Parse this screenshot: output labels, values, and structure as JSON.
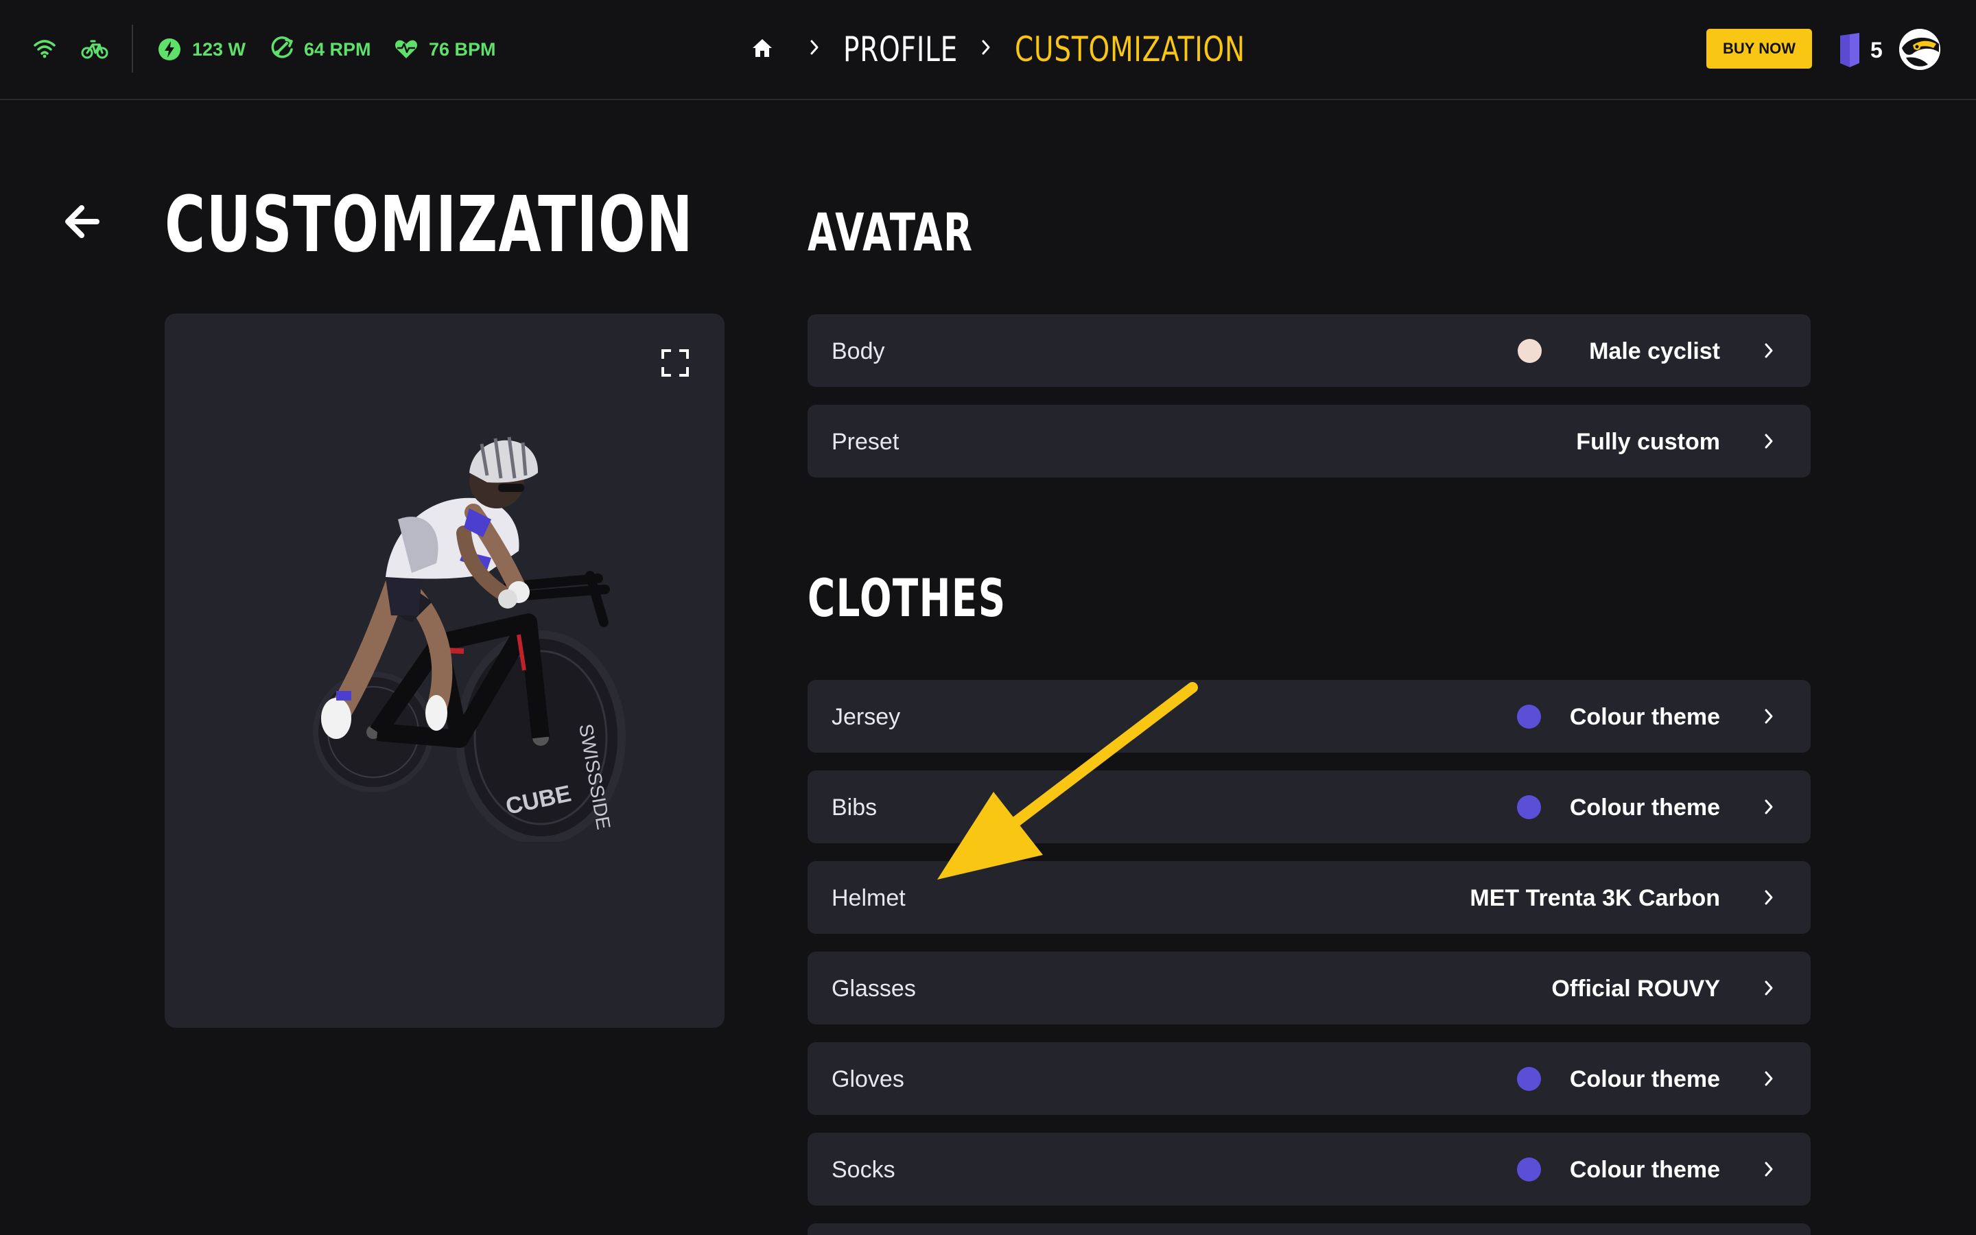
{
  "topbar": {
    "stats": [
      {
        "icon": "bolt-icon",
        "value": "123 W"
      },
      {
        "icon": "cadence-icon",
        "value": "64 RPM"
      },
      {
        "icon": "heart-rate-icon",
        "value": "76 BPM"
      }
    ],
    "breadcrumb": {
      "home_icon": "home-icon",
      "items": [
        "PROFILE",
        "CUSTOMIZATION"
      ]
    },
    "buy_now": "BUY NOW",
    "level": "5"
  },
  "page": {
    "title": "CUSTOMIZATION"
  },
  "avatar_section": {
    "title": "AVATAR",
    "rows": [
      {
        "label": "Body",
        "value": "Male cyclist",
        "swatch": "#f3ddd2"
      },
      {
        "label": "Preset",
        "value": "Fully custom"
      }
    ]
  },
  "clothes_section": {
    "title": "CLOTHES",
    "rows": [
      {
        "label": "Jersey",
        "value": "Colour theme",
        "swatch": "#5b4fd8"
      },
      {
        "label": "Bibs",
        "value": "Colour theme",
        "swatch": "#5b4fd8"
      },
      {
        "label": "Helmet",
        "value": "MET Trenta 3K Carbon"
      },
      {
        "label": "Glasses",
        "value": "Official ROUVY"
      },
      {
        "label": "Gloves",
        "value": "Colour theme",
        "swatch": "#5b4fd8"
      },
      {
        "label": "Socks",
        "value": "Colour theme",
        "swatch": "#5b4fd8"
      }
    ]
  },
  "colors": {
    "accent_yellow": "#f9c713",
    "stat_green": "#5ee06a",
    "row_bg": "#24242c",
    "page_bg": "#121215",
    "theme_purple": "#5b4fd8"
  }
}
